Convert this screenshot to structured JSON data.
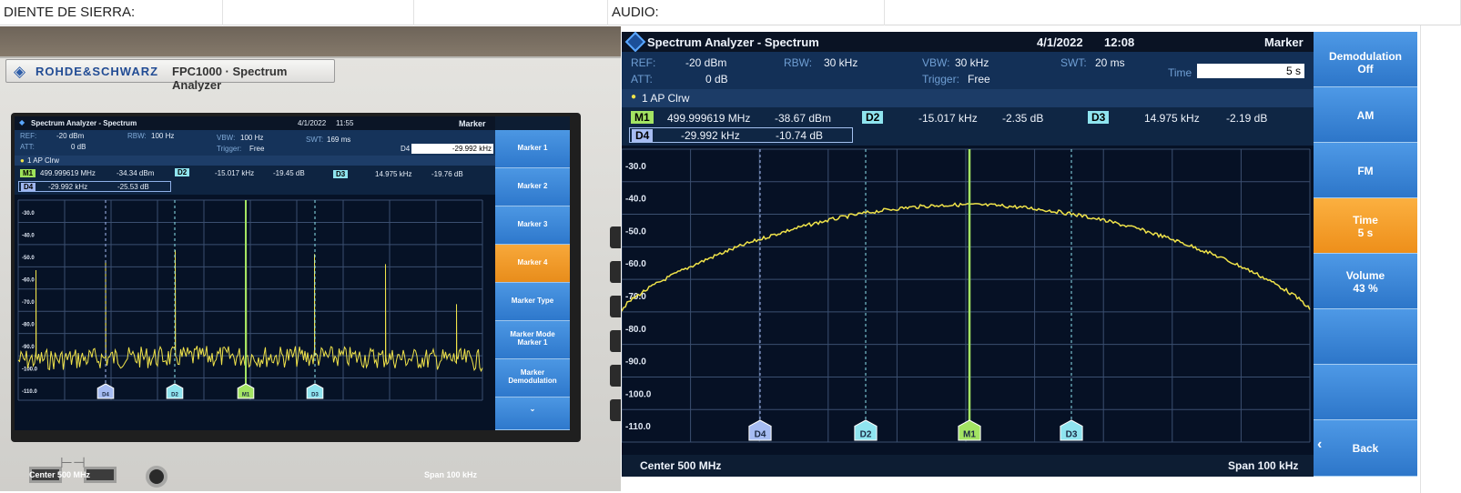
{
  "sheet": {
    "left_label": "DIENTE DE SIERRA:",
    "right_label": "AUDIO:"
  },
  "device": {
    "brand": "ROHDE&SCHWARZ",
    "model": "FPC1000 · Spectrum Analyzer"
  },
  "left_screen": {
    "title": "Spectrum Analyzer - Spectrum",
    "date": "4/1/2022",
    "time": "11:55",
    "panel": "Marker",
    "ref_label": "REF:",
    "ref_value": "-20 dBm",
    "att_label": "ATT:",
    "att_value": "0 dB",
    "rbw_label": "RBW:",
    "rbw_value": "100 Hz",
    "vbw_label": "VBW:",
    "vbw_value": "100 Hz",
    "trigger_label": "Trigger:",
    "trigger_value": "Free",
    "swt_label": "SWT:",
    "swt_value": "169 ms",
    "field_label": "D4",
    "field_value": "-29.992 kHz",
    "trace": "1 AP  Clrw",
    "markers": {
      "m1_tag": "M1",
      "m1_freq": "499.999619 MHz",
      "m1_level": "-34.34 dBm",
      "d2_tag": "D2",
      "d2_freq": "-15.017 kHz",
      "d2_level": "-19.45 dB",
      "d3_tag": "D3",
      "d3_freq": "14.975 kHz",
      "d3_level": "-19.76 dB",
      "d4_tag": "D4",
      "d4_freq": "-29.992 kHz",
      "d4_level": "-25.53 dB"
    },
    "y_ticks": [
      "-30.0",
      "-40.0",
      "-50.0",
      "-60.0",
      "-70.0",
      "-80.0",
      "-90.0",
      "-100.0",
      "-110.0"
    ],
    "center": "Center 500 MHz",
    "span": "Span 100 kHz",
    "softkeys": [
      "Marker 1",
      "Marker 2",
      "Marker 3",
      "Marker 4",
      "Marker Type",
      "Marker Mode\nMarker 1",
      "Marker\nDemodulation"
    ],
    "active_softkey": "Marker 4",
    "marker_flags": [
      "D4",
      "D2",
      "M1",
      "D3"
    ]
  },
  "right_screen": {
    "title": "Spectrum Analyzer - Spectrum",
    "date": "4/1/2022",
    "time": "12:08",
    "panel": "Marker",
    "ref_label": "REF:",
    "ref_value": "-20 dBm",
    "att_label": "ATT:",
    "att_value": "0 dB",
    "rbw_label": "RBW:",
    "rbw_value": "30 kHz",
    "vbw_label": "VBW:",
    "vbw_value": "30 kHz",
    "trigger_label": "Trigger:",
    "trigger_value": "Free",
    "swt_label": "SWT:",
    "swt_value": "20 ms",
    "field_label": "Time",
    "field_value": "5 s",
    "trace": "1 AP  Clrw",
    "markers": {
      "m1_tag": "M1",
      "m1_freq": "499.999619 MHz",
      "m1_level": "-38.67 dBm",
      "d2_tag": "D2",
      "d2_freq": "-15.017 kHz",
      "d2_level": "-2.35 dB",
      "d3_tag": "D3",
      "d3_freq": "14.975 kHz",
      "d3_level": "-2.19 dB",
      "d4_tag": "D4",
      "d4_freq": "-29.992 kHz",
      "d4_level": "-10.74 dB"
    },
    "y_ticks": [
      "-30.0",
      "-40.0",
      "-50.0",
      "-60.0",
      "-70.0",
      "-80.0",
      "-90.0",
      "-100.0",
      "-110.0"
    ],
    "center": "Center 500 MHz",
    "span": "Span 100 kHz",
    "softkeys": [
      {
        "label": "Demodulation",
        "sub": "Off"
      },
      {
        "label": "AM",
        "sub": ""
      },
      {
        "label": "FM",
        "sub": ""
      },
      {
        "label": "Time",
        "sub": "5 s"
      },
      {
        "label": "Volume",
        "sub": "43 %"
      },
      {
        "label": "",
        "sub": ""
      },
      {
        "label": "",
        "sub": ""
      },
      {
        "label": "Back",
        "sub": ""
      }
    ],
    "active_softkey": "Time",
    "marker_flags": [
      "D4",
      "D2",
      "M1",
      "D3"
    ]
  },
  "colors": {
    "trace": "#f0e34a",
    "marker_green": "#a3e463",
    "marker_cyan": "#8fe4ef",
    "marker_blue": "#a6bcf2",
    "softkey": "#3b86d6",
    "softkey_active": "#f59a2a"
  }
}
